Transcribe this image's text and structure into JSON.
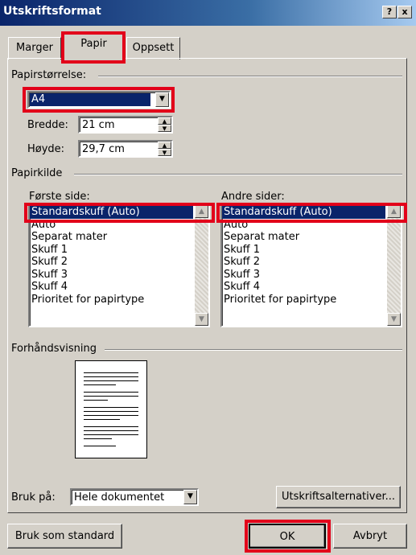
{
  "window": {
    "title": "Utskriftsformat",
    "help_button": "?",
    "close_button": "x"
  },
  "tabs": [
    {
      "label": "Marger"
    },
    {
      "label": "Papir"
    },
    {
      "label": "Oppsett"
    }
  ],
  "paper_size": {
    "section_label": "Papirstørrelse:",
    "selected": "A4",
    "width_label": "Bredde:",
    "width_value": "21 cm",
    "height_label": "Høyde:",
    "height_value": "29,7 cm"
  },
  "paper_source": {
    "section_label": "Papirkilde",
    "first_page_label": "Første side:",
    "other_pages_label": "Andre sider:",
    "options": [
      "Standardskuff (Auto)",
      "Auto",
      "Separat mater",
      "Skuff 1",
      "Skuff 2",
      "Skuff 3",
      "Skuff 4",
      "Prioritet for papirtype"
    ],
    "first_page_selected": "Standardskuff (Auto)",
    "other_pages_selected": "Standardskuff (Auto)"
  },
  "preview": {
    "section_label": "Forhåndsvisning"
  },
  "apply_to": {
    "label": "Bruk på:",
    "selected": "Hele dokumentet"
  },
  "buttons": {
    "print_options": "Utskriftsalternativer...",
    "default": "Bruk som standard",
    "ok": "OK",
    "cancel": "Avbryt"
  },
  "colors": {
    "highlight_box": "#e2001a",
    "selection": "#0a246a",
    "dialog_face": "#d4d0c8"
  },
  "icons": {
    "spin_up": "triangle-up",
    "spin_down": "triangle-down",
    "dropdown": "triangle-down",
    "scroll_up": "triangle-up",
    "scroll_down": "triangle-down"
  }
}
